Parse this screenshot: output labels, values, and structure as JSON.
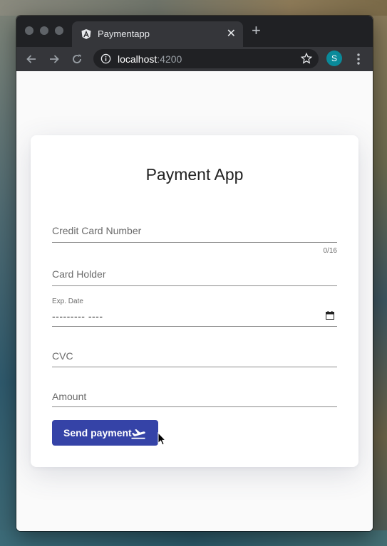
{
  "tab": {
    "title": "Paymentapp"
  },
  "address": {
    "host": "localhost",
    "port": ":4200"
  },
  "profile": {
    "initial": "S"
  },
  "form": {
    "title": "Payment App",
    "card_number": {
      "label": "Credit Card Number",
      "counter": "0/16"
    },
    "card_holder": {
      "label": "Card Holder"
    },
    "exp_date": {
      "label": "Exp. Date",
      "value": "--------- ----"
    },
    "cvc": {
      "label": "CVC"
    },
    "amount": {
      "label": "Amount"
    },
    "send_label": "Send payment"
  },
  "colors": {
    "accent": "#3543a7",
    "avatar": "#0a8a9a",
    "chrome_dark": "#202124",
    "chrome": "#35363a"
  },
  "icons": [
    "angular-icon",
    "close-icon",
    "plus-icon",
    "back-icon",
    "forward-icon",
    "reload-icon",
    "info-icon",
    "star-icon",
    "menu-icon",
    "calendar-icon",
    "flight-takeoff-icon",
    "cursor-icon"
  ]
}
